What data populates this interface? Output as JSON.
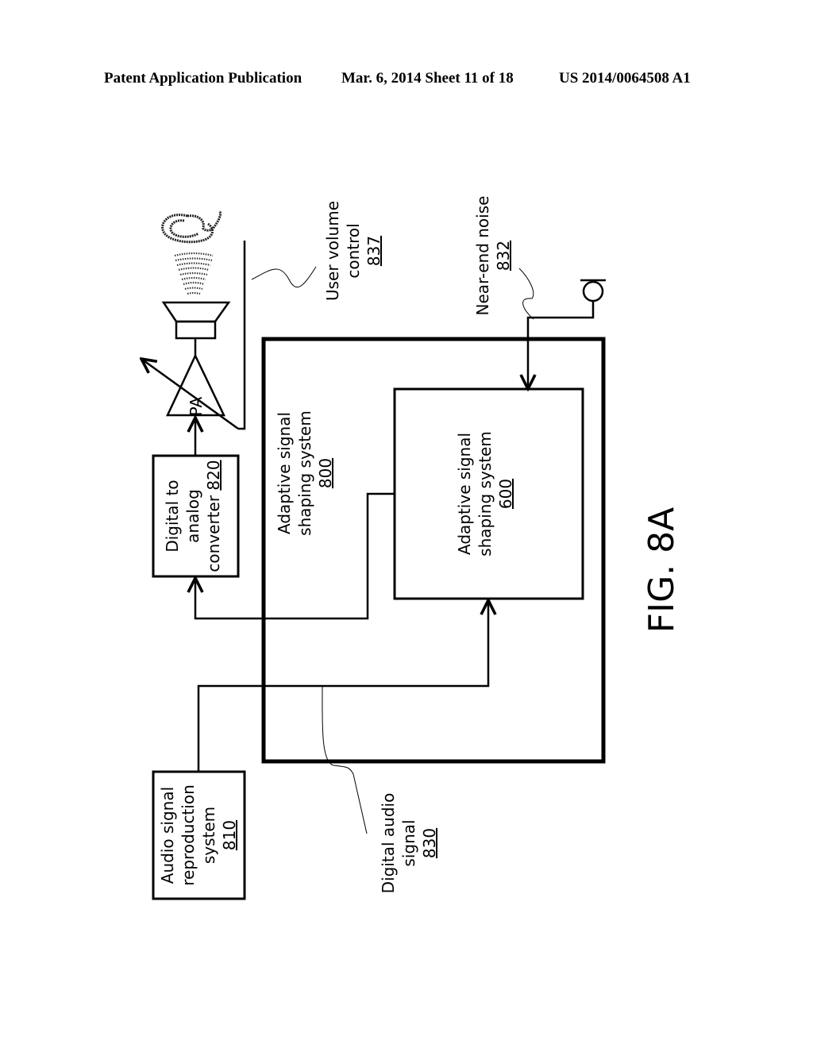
{
  "header": {
    "publication": "Patent Application Publication",
    "date_sheet": "Mar. 6, 2014   Sheet 11 of 18",
    "patent_number": "US 2014/0064508 A1"
  },
  "figure_label": "FIG. 8A",
  "blocks": {
    "audio_source": {
      "lines": [
        "Audio signal",
        "reproduction",
        "system"
      ],
      "ref": "810"
    },
    "dac": {
      "lines": [
        "Digital to",
        "analog"
      ],
      "line3": "converter ",
      "ref": "820"
    },
    "outer_system": {
      "lines": [
        "Adaptive signal",
        "shaping system"
      ],
      "ref": "800"
    },
    "inner_system": {
      "lines": [
        "Adaptive signal",
        "shaping system"
      ],
      "ref": "600"
    },
    "amplifier": {
      "label": "PA"
    }
  },
  "callouts": {
    "volume": {
      "lines": [
        "User volume",
        "control"
      ],
      "ref": "837"
    },
    "noise": {
      "line": "Near-end noise",
      "ref": "832"
    },
    "digital_audio": {
      "lines": [
        "Digital audio",
        "signal"
      ],
      "ref": "830"
    }
  },
  "icons": [
    "ear-icon",
    "sound-waves-icon",
    "speaker-icon",
    "amplifier-icon",
    "microphone-icon"
  ]
}
